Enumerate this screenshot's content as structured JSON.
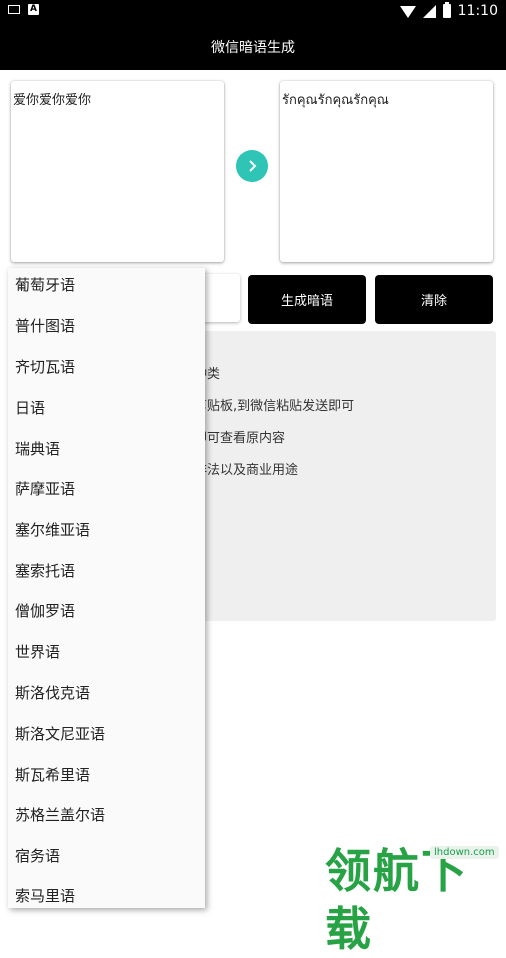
{
  "status_bar": {
    "time": "11:10"
  },
  "app_bar": {
    "title": "微信暗语生成"
  },
  "input": {
    "text": "爱你爱你爱你"
  },
  "output": {
    "text": "รักคุณรักคุณรักคุณ"
  },
  "buttons": {
    "generate": "生成暗语",
    "clear": "清除"
  },
  "info_lines": [
    "种类",
    "剪贴板,到微信粘贴发送即可",
    "即可查看原内容",
    "非法以及商业用途"
  ],
  "language_menu": {
    "items": [
      "葡萄牙语",
      "普什图语",
      "齐切瓦语",
      "日语",
      "瑞典语",
      "萨摩亚语",
      "塞尔维亚语",
      "塞索托语",
      "僧伽罗语",
      "世界语",
      "斯洛伐克语",
      "斯洛文尼亚语",
      "斯瓦希里语",
      "苏格兰盖尔语",
      "宿务语",
      "索马里语"
    ]
  },
  "watermark": {
    "text": "领航下载",
    "url": "lhdown.com"
  },
  "colors": {
    "accent": "#2ec4b6",
    "bar": "#000000",
    "watermark": "#27a346"
  }
}
